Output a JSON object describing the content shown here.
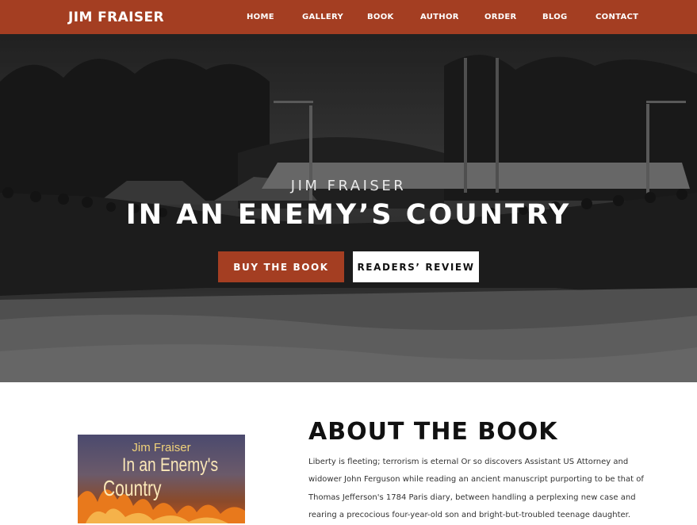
{
  "header": {
    "logo": "JIM FRAISER",
    "nav": [
      "HOME",
      "GALLERY",
      "BOOK",
      "AUTHOR",
      "ORDER",
      "BLOG",
      "CONTACT"
    ]
  },
  "hero": {
    "author": "JIM FRAISER",
    "title": "IN AN ENEMY’S COUNTRY",
    "buy_button": "BUY THE BOOK",
    "review_button": "READERS’ REVIEW"
  },
  "about": {
    "cover_author": "Jim Fraiser",
    "cover_title_line1": "In an Enemy's",
    "cover_title_line2": "Country",
    "heading": "ABOUT THE BOOK",
    "paragraph_lines": [
      "Liberty is fleeting; terrorism is eternal Or so discovers Assistant US Attorney and",
      "widower John Ferguson while reading an ancient manuscript purporting to be that of",
      "Thomas Jefferson's 1784 Paris diary, between handling a perplexing new case and",
      "rearing a precocious four-year-old son and bright-but-troubled teenage daughter."
    ]
  },
  "colors": {
    "brand": "#a43e22",
    "header_text": "#ffffff",
    "review_button_bg": "#ffffff",
    "heading_text": "#111111"
  }
}
